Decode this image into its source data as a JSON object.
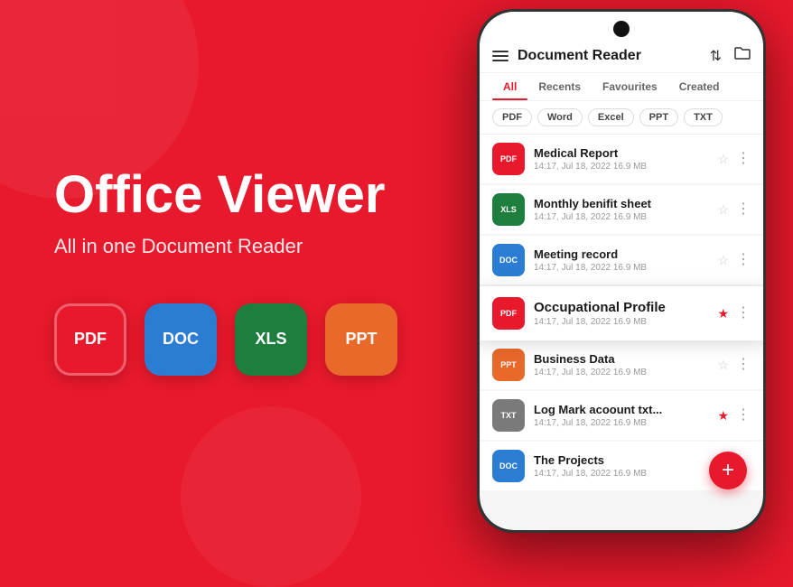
{
  "app": {
    "bg_color": "#e8192c",
    "main_title": "Office Viewer",
    "subtitle": "All in one Document Reader",
    "icons": [
      {
        "label": "PDF",
        "type": "pdf"
      },
      {
        "label": "DOC",
        "type": "doc"
      },
      {
        "label": "XLS",
        "type": "xls"
      },
      {
        "label": "PPT",
        "type": "ppt"
      }
    ]
  },
  "phone": {
    "header": {
      "title": "Document Reader",
      "sort_icon": "↕",
      "folder_icon": "🗁"
    },
    "tabs": [
      {
        "label": "All",
        "active": true
      },
      {
        "label": "Recents",
        "active": false
      },
      {
        "label": "Favourites",
        "active": false
      },
      {
        "label": "Created",
        "active": false
      }
    ],
    "filters": [
      {
        "label": "PDF",
        "active": false
      },
      {
        "label": "Word",
        "active": false
      },
      {
        "label": "Excel",
        "active": false
      },
      {
        "label": "PPT",
        "active": false
      },
      {
        "label": "TXT",
        "active": false
      }
    ],
    "files": [
      {
        "name": "Medical Report",
        "meta": "14:17, Jul 18, 2022  16.9 MB",
        "type": "pdf",
        "starred": false,
        "highlighted": false
      },
      {
        "name": "Monthly benifit sheet",
        "meta": "14:17, Jul 18, 2022  16.9 MB",
        "type": "xls",
        "starred": false,
        "highlighted": false
      },
      {
        "name": "Meeting record",
        "meta": "14:17, Jul 18, 2022  16.9 MB",
        "type": "doc",
        "starred": false,
        "highlighted": false
      },
      {
        "name": "Occupational Profile",
        "meta": "14:17, Jul 18, 2022  16.9 MB",
        "type": "pdf",
        "starred": true,
        "highlighted": true
      },
      {
        "name": "Business Data",
        "meta": "14:17, Jul 18, 2022  16.9 MB",
        "type": "ppt",
        "starred": false,
        "highlighted": false
      },
      {
        "name": "Log Mark acoount txt...",
        "meta": "14:17, Jul 18, 2022  16.9 MB",
        "type": "txt",
        "starred": true,
        "highlighted": false
      },
      {
        "name": "The Projects",
        "meta": "14:17, Jul 18, 2022  16.9 MB",
        "type": "doc",
        "starred": false,
        "highlighted": false
      }
    ],
    "fab_label": "+"
  }
}
